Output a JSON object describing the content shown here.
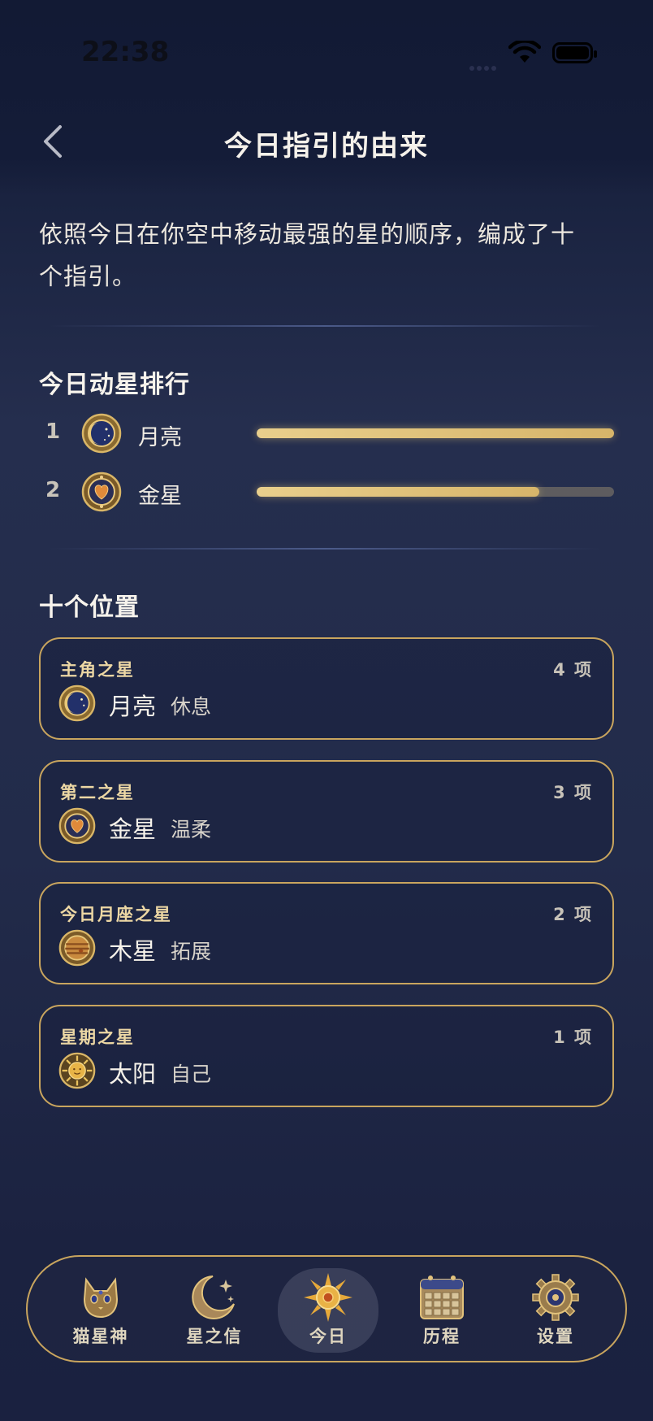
{
  "status": {
    "time": "22:38"
  },
  "nav": {
    "title": "今日指引的由来"
  },
  "intro": {
    "text_line1": "依照今日在你空中移动最强的星的顺序，编成了十",
    "text_line2": "个指引。"
  },
  "ranking": {
    "title": "今日动星排行",
    "items": [
      {
        "rank": "1",
        "name": "月亮",
        "icon": "moon-icon",
        "strength": 1.0
      },
      {
        "rank": "2",
        "name": "金星",
        "icon": "venus-icon",
        "strength": 0.79
      }
    ]
  },
  "positions": {
    "title": "十个位置",
    "cards": [
      {
        "label": "主角之星",
        "count": "4 项",
        "planet": "月亮",
        "trait": "休息",
        "icon": "moon-icon"
      },
      {
        "label": "第二之星",
        "count": "3 项",
        "planet": "金星",
        "trait": "温柔",
        "icon": "venus-icon"
      },
      {
        "label": "今日月座之星",
        "count": "2 项",
        "planet": "木星",
        "trait": "拓展",
        "icon": "jupiter-icon"
      },
      {
        "label": "星期之星",
        "count": "1 项",
        "planet": "太阳",
        "trait": "自己",
        "icon": "sun-icon"
      }
    ]
  },
  "tabbar": {
    "tabs": [
      {
        "label": "猫星神",
        "icon": "cat-icon"
      },
      {
        "label": "星之信",
        "icon": "crescent-icon"
      },
      {
        "label": "今日",
        "icon": "sun-icon",
        "active": true
      },
      {
        "label": "历程",
        "icon": "calendar-icon"
      },
      {
        "label": "设置",
        "icon": "gear-icon"
      }
    ]
  },
  "colors": {
    "accent_gold": "#c9a55e",
    "bar_gold": "#e2c47c",
    "background": "#222b4a"
  }
}
